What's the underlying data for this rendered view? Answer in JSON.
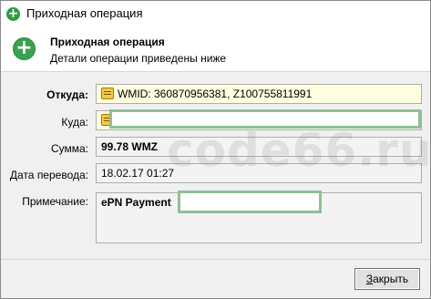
{
  "window": {
    "title": "Приходная операция"
  },
  "header": {
    "title": "Приходная операция",
    "subtitle": "Детали операции приведены ниже"
  },
  "fields": {
    "from": {
      "label": "Откуда:",
      "value": "WMID: 360870956381, Z100755811991"
    },
    "to": {
      "label": "Куда:",
      "value": ""
    },
    "amount": {
      "label": "Сумма:",
      "value": "99.78 WMZ"
    },
    "date": {
      "label": "Дата перевода:",
      "value": "18.02.17 01:27"
    },
    "note": {
      "label": "Примечание:",
      "value": "ePN Payment"
    }
  },
  "watermark": "code66.ru",
  "buttons": {
    "close_prefix": "",
    "close_mnemonic": "З",
    "close_rest": "акрыть"
  },
  "colors": {
    "accent_green": "#3aa14e",
    "highlight_field": "#ffffe0",
    "redaction_border": "#8fbf96"
  }
}
